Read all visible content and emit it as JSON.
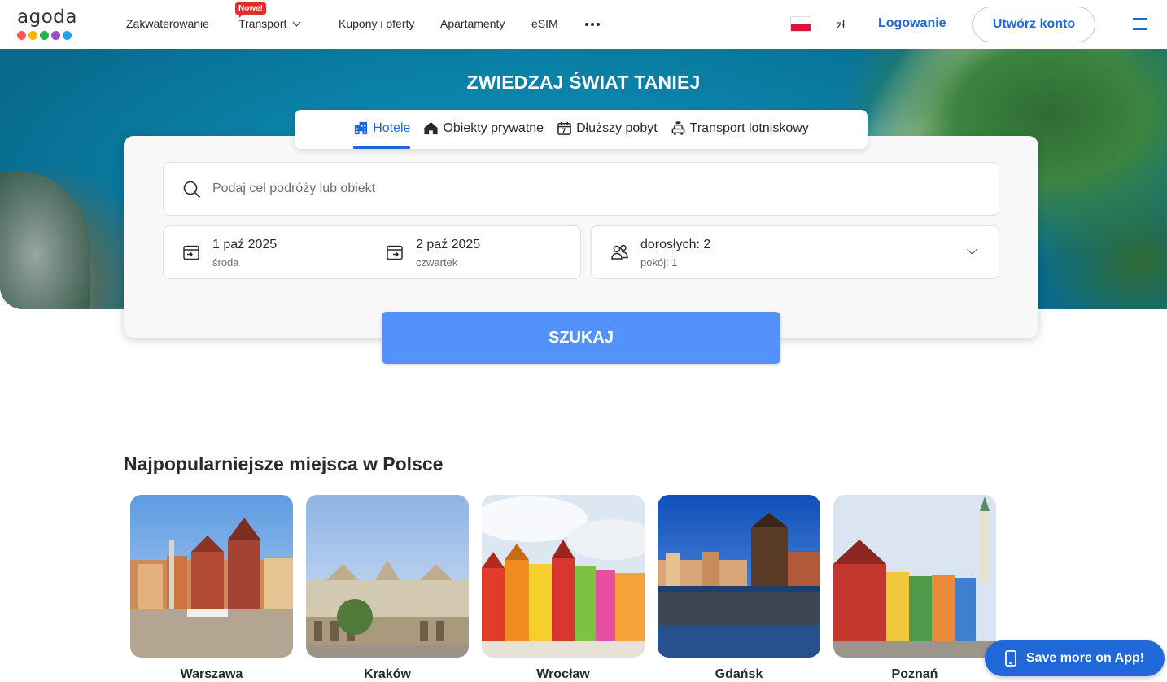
{
  "header": {
    "logo_text": "agoda",
    "logo_dot_colors": [
      "#ff5a5a",
      "#f7b500",
      "#27b14e",
      "#9b4dca",
      "#22a3e3"
    ],
    "nav": [
      {
        "label": "Zakwaterowanie"
      },
      {
        "label": "Transport",
        "badge": "Nowe!",
        "has_dropdown": true
      },
      {
        "label": "Kupony i oferty"
      },
      {
        "label": "Apartamenty"
      },
      {
        "label": "eSIM"
      }
    ],
    "more_icon": "more-dots-icon",
    "currency": "zł",
    "login": "Logowanie",
    "create_account": "Utwórz konto"
  },
  "hero": {
    "title": "ZWIEDZAJ ŚWIAT TANIEJ"
  },
  "search": {
    "tabs": [
      {
        "label": "Hotele",
        "icon": "hotel-icon",
        "active": true
      },
      {
        "label": "Obiekty prywatne",
        "icon": "house-icon",
        "active": false
      },
      {
        "label": "Dłuższy pobyt",
        "icon": "calendar-7-icon",
        "active": false
      },
      {
        "label": "Transport lotniskowy",
        "icon": "taxi-icon",
        "active": false
      }
    ],
    "destination_placeholder": "Podaj cel podróży lub obiekt",
    "checkin": {
      "date": "1 paź 2025",
      "weekday": "środa"
    },
    "checkout": {
      "date": "2 paź 2025",
      "weekday": "czwartek"
    },
    "guests": {
      "adults": "dorosłych: 2",
      "rooms": "pokój: 1"
    },
    "button": "SZUKAJ"
  },
  "popular": {
    "title": "Najpopularniejsze miejsca w Polsce",
    "cities": [
      {
        "name": "Warszawa"
      },
      {
        "name": "Kraków"
      },
      {
        "name": "Wrocław"
      },
      {
        "name": "Gdańsk"
      },
      {
        "name": "Poznań"
      }
    ]
  },
  "app_button": "Save more on App!",
  "colors": {
    "brand_blue": "#2067da",
    "search_button": "#5392f9",
    "badge_red": "#e12d2d"
  }
}
